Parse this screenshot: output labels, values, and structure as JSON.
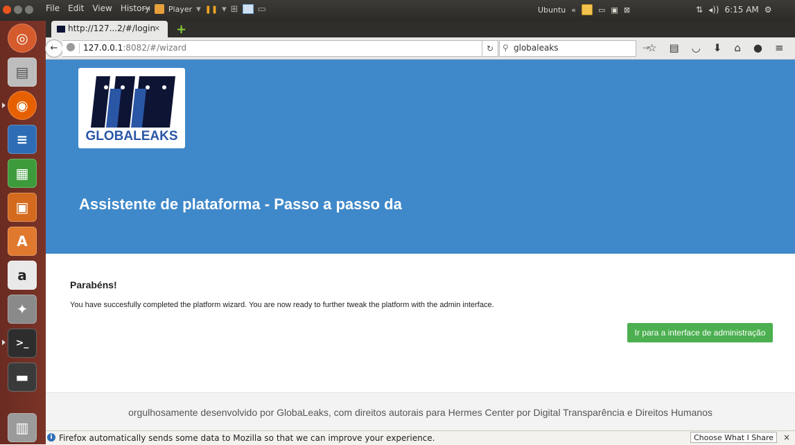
{
  "top_panel": {
    "menu": [
      "File",
      "Edit",
      "View",
      "History"
    ],
    "player_label": "Player",
    "ubuntu_label": "Ubuntu",
    "clock": "6:15 AM"
  },
  "tab": {
    "title": "http://127...2/#/login",
    "close": "×",
    "new_tab": "+"
  },
  "navbar": {
    "url_host": "127.0.0.1",
    "url_rest": ":8082/#/wizard",
    "search_value": "globaleaks"
  },
  "logo": {
    "text": "GLOBALEAKS",
    "colors": {
      "brand_blue": "#2a56a6",
      "brand_dark": "#0e1434"
    }
  },
  "hero": {
    "title": "Assistente de plataforma - Passo a passo da",
    "background": "#3f88c9"
  },
  "content": {
    "heading": "Parabéns!",
    "message": "You have succesfully completed the platform wizard. You are now ready to further tweak the platform with the admin interface.",
    "admin_button": "Ir para a interface de administração",
    "button_color": "#4cb050"
  },
  "footer": {
    "text": "orgulhosamente desenvolvido por GlobaLeaks, com direitos autorais para Hermes Center por Digital Transparência e Direitos Humanos"
  },
  "notification": {
    "text": "Firefox automatically sends some data to Mozilla so that we can improve your experience.",
    "button": "Choose What I Share",
    "close": "×"
  },
  "launcher": {
    "icons": [
      "ubuntu-dash-icon",
      "files-icon",
      "firefox-icon",
      "writer-icon",
      "calc-icon",
      "impress-icon",
      "software-center-icon",
      "amazon-icon",
      "system-settings-icon",
      "terminal-icon",
      "save-disk-icon",
      "trash-icon"
    ]
  }
}
